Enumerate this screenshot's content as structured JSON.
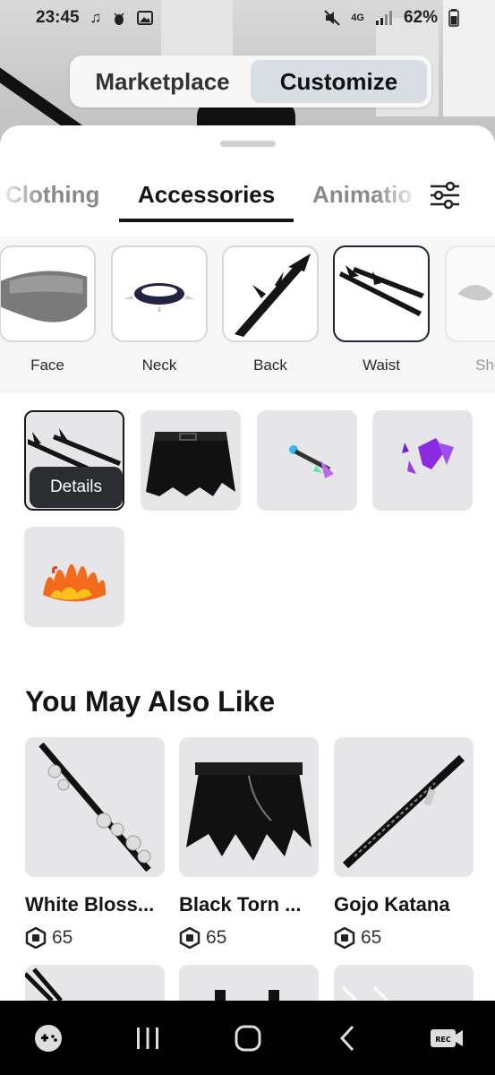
{
  "status_bar": {
    "time": "23:45",
    "network": "4G",
    "battery": "62%",
    "icons": [
      "music-note-icon",
      "bug-icon",
      "image-icon",
      "mute-icon",
      "signal-icon",
      "battery-icon"
    ]
  },
  "segmented": {
    "options": [
      "Marketplace",
      "Customize"
    ],
    "active": "Customize"
  },
  "tabs": {
    "items": [
      "Clothing",
      "Accessories",
      "Animatio"
    ],
    "active": "Accessories"
  },
  "subcategories": {
    "items": [
      "Face",
      "Neck",
      "Back",
      "Waist",
      "Shou"
    ],
    "active": "Waist"
  },
  "owned_items": {
    "details_label": "Details",
    "icons": [
      "twin-swords-icon",
      "black-skirt-icon",
      "glowing-dagger-icon",
      "purple-shards-icon",
      "fire-crown-icon"
    ]
  },
  "recommendations": {
    "title": "You May Also Like",
    "items": [
      {
        "name": "White Bloss...",
        "price": "65",
        "icon": "blossom-sword-icon"
      },
      {
        "name": "Black Torn ...",
        "price": "65",
        "icon": "torn-skirt-icon"
      },
      {
        "name": "Gojo Katana",
        "price": "65",
        "icon": "katana-icon"
      }
    ]
  },
  "colors": {
    "accent_dark": "#151515",
    "tile_bg": "#e6e6e8",
    "active_border": "#1d2536"
  }
}
